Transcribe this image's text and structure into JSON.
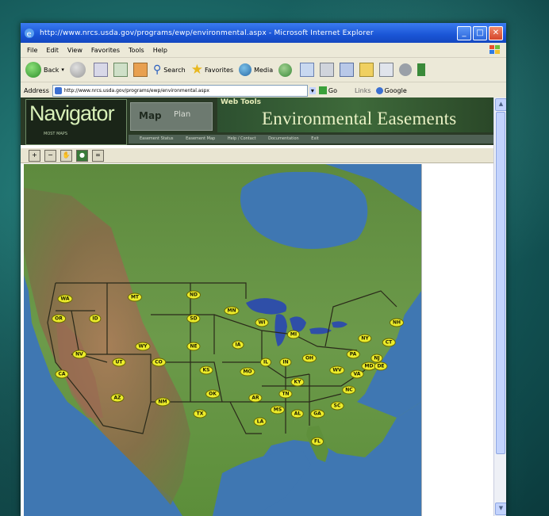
{
  "window": {
    "title": "http://www.nrcs.usda.gov/programs/ewp/environmental.aspx - Microsoft Internet Explorer",
    "buttons": {
      "minimize": "_",
      "maximize": "□",
      "close": "✕"
    }
  },
  "menu": [
    "File",
    "Edit",
    "View",
    "Favorites",
    "Tools",
    "Help"
  ],
  "toolbar": {
    "back": "Back",
    "search": "Search",
    "favorites": "Favorites",
    "media": "Media"
  },
  "address": {
    "label": "Address",
    "url": "http://www.nrcs.usda.gov/programs/ewp/environmental.aspx",
    "go": "Go",
    "links": "Links",
    "google": "Google"
  },
  "banner": {
    "logo": "Navigator",
    "logo_sub": "MOST MAPS",
    "map_tab": "Map",
    "map_tab_right": "Plan",
    "title_small": "Web Tools",
    "title_big": "Environmental Easements",
    "nav_items": [
      "Easement Status",
      "Easement Map",
      "Help / Contact",
      "Documentation",
      "Exit"
    ]
  },
  "map_tools": [
    "zoom-in",
    "zoom-out",
    "pan",
    "globe",
    "binoculars"
  ],
  "map": {
    "colors": {
      "ocean": "#3f77b2",
      "land": "#6b9a4a",
      "mountains": "#8a6a50",
      "lakes": "#2f4fa8"
    },
    "state_labels": [
      {
        "abbr": "WA"
      },
      {
        "abbr": "OR"
      },
      {
        "abbr": "ID"
      },
      {
        "abbr": "MT"
      },
      {
        "abbr": "WY"
      },
      {
        "abbr": "NV"
      },
      {
        "abbr": "UT"
      },
      {
        "abbr": "CO"
      },
      {
        "abbr": "CA"
      },
      {
        "abbr": "AZ"
      },
      {
        "abbr": "NM"
      },
      {
        "abbr": "ND"
      },
      {
        "abbr": "SD"
      },
      {
        "abbr": "NE"
      },
      {
        "abbr": "KS"
      },
      {
        "abbr": "OK"
      },
      {
        "abbr": "TX"
      },
      {
        "abbr": "MN"
      },
      {
        "abbr": "IA"
      },
      {
        "abbr": "MO"
      },
      {
        "abbr": "AR"
      },
      {
        "abbr": "LA"
      },
      {
        "abbr": "WI"
      },
      {
        "abbr": "IL"
      },
      {
        "abbr": "MI"
      },
      {
        "abbr": "IN"
      },
      {
        "abbr": "OH"
      },
      {
        "abbr": "KY"
      },
      {
        "abbr": "TN"
      },
      {
        "abbr": "MS"
      },
      {
        "abbr": "AL"
      },
      {
        "abbr": "GA"
      },
      {
        "abbr": "FL"
      },
      {
        "abbr": "SC"
      },
      {
        "abbr": "NC"
      },
      {
        "abbr": "VA"
      },
      {
        "abbr": "WV"
      },
      {
        "abbr": "PA"
      },
      {
        "abbr": "NY"
      },
      {
        "abbr": "NJ"
      },
      {
        "abbr": "MD"
      },
      {
        "abbr": "DE"
      },
      {
        "abbr": "CT"
      },
      {
        "abbr": "NH"
      }
    ]
  }
}
